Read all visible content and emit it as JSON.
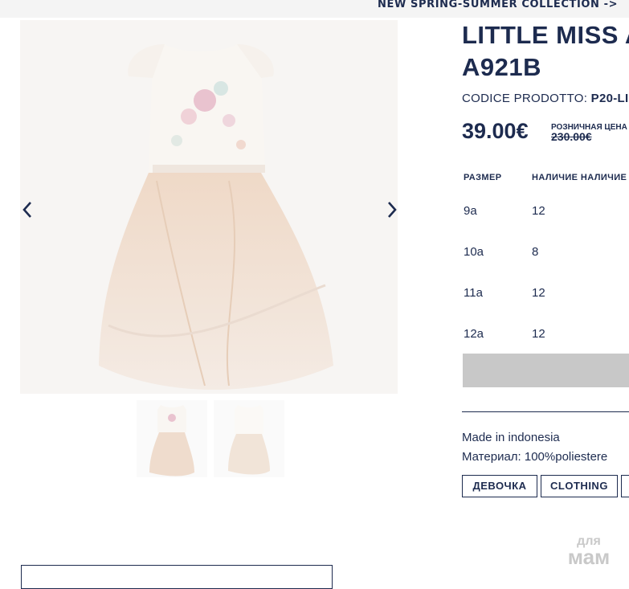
{
  "promo": {
    "label": "NEW SPRING-SUMMER COLLECTION ->"
  },
  "product": {
    "title_line1": "LITTLE MISS A",
    "title_line2": "A921B",
    "code_label": "CODICE PRODOTTO:",
    "code_value": "P20-LI",
    "price": "39.00€",
    "retail_label": "РОЗНИЧНАЯ ЦЕНА",
    "retail_value": "230.00€"
  },
  "sizes": {
    "headers": [
      "РАЗМЕР",
      "НАЛИЧИЕ НАЛИЧИЕ"
    ],
    "rows": [
      {
        "size": "9a",
        "stock": "12"
      },
      {
        "size": "10a",
        "stock": "8"
      },
      {
        "size": "11a",
        "stock": "12"
      },
      {
        "size": "12a",
        "stock": "12"
      }
    ]
  },
  "details": {
    "made_in": "Made in indonesia",
    "material": "Материал: 100%poliestere"
  },
  "tags": [
    "ДЕВОЧКА",
    "CLOTHING"
  ],
  "logo": {
    "line1": "для",
    "line2": "мам"
  },
  "colors": {
    "text": "#1d2b4f",
    "button_disabled": "#c8c8c8",
    "dress": "#f2e3d6"
  },
  "icons": {
    "prev": "chevron-left-icon",
    "next": "chevron-right-icon"
  }
}
